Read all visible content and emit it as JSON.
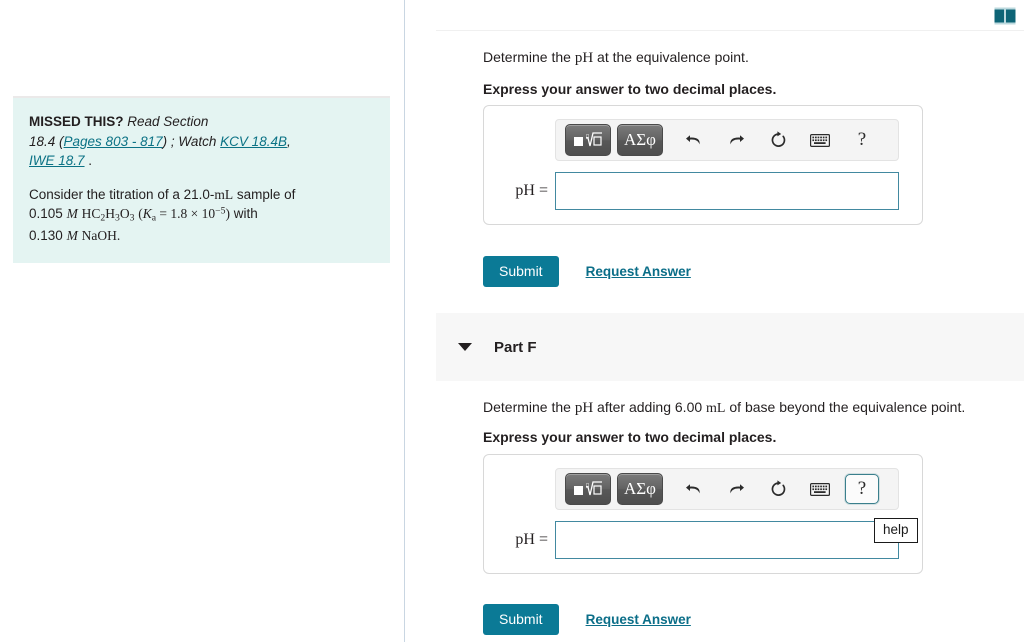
{
  "left_panel": {
    "callout": {
      "missed_label": "MISSED THIS?",
      "read_label": "Read Section",
      "section": "18.4",
      "pages_link": "Pages 803 - 817",
      "watch_label": "; Watch",
      "kcv_link": "KCV 18.4B",
      "iwe_link": "IWE 18.7",
      "trailing_period": ".",
      "problem_line1_a": "Consider the titration of a 21.0-",
      "problem_line1_unit": "mL",
      "problem_line1_b": " sample of",
      "problem_conc1": "0.105",
      "problem_molar1": "M",
      "problem_acid": "HC",
      "problem_acid_sub1": "2",
      "problem_acid_h": "H",
      "problem_acid_sub2": "3",
      "problem_acid_o": "O",
      "problem_acid_sub3": "3",
      "problem_ka_open": "(",
      "problem_ka_sym": "K",
      "problem_ka_sub": "a",
      "problem_ka_eq": "= 1.8 × 10",
      "problem_ka_exp": "−5",
      "problem_ka_close": ")",
      "problem_with": "with",
      "problem_conc2": "0.130",
      "problem_molar2": "M",
      "problem_base": "NaOH."
    }
  },
  "right_panel": {
    "book_icon": "book-icon",
    "part_e": {
      "question_a": "Determine the ",
      "question_ph": "pH",
      "question_b": " at the equivalence point.",
      "instruction": "Express your answer to two decimal places.",
      "math_toolbar": {
        "template_button": "template-button",
        "greek_button": "ΑΣφ",
        "undo_icon": "undo-icon",
        "redo_icon": "redo-icon",
        "reset_icon": "reset-icon",
        "keyboard_icon": "keyboard-icon",
        "help_label": "?"
      },
      "answer_label": "pH =",
      "answer_value": "",
      "answer_placeholder": "",
      "submit_label": "Submit",
      "request_answer_label": "Request Answer"
    },
    "part_f": {
      "title": "Part F",
      "caret_icon": "chevron-down-icon",
      "question_a": "Determine the ",
      "question_ph": "pH",
      "question_b": " after adding 6.00 ",
      "question_unit": "mL",
      "question_c": " of base beyond the equivalence point.",
      "instruction": "Express your answer to two decimal places.",
      "math_toolbar": {
        "template_button": "template-button",
        "greek_button": "ΑΣφ",
        "undo_icon": "undo-icon",
        "redo_icon": "redo-icon",
        "reset_icon": "reset-icon",
        "keyboard_icon": "keyboard-icon",
        "help_label": "?"
      },
      "help_tooltip": "help",
      "answer_label": "pH =",
      "answer_value": "",
      "answer_placeholder": "",
      "submit_label": "Submit",
      "request_answer_label": "Request Answer"
    }
  },
  "colors": {
    "accent_teal": "#0b7a96",
    "link_teal": "#0b6e88",
    "callout_bg": "#e4f4f2",
    "input_border": "#4289a0",
    "part_header_bg": "#f7f7f7"
  }
}
